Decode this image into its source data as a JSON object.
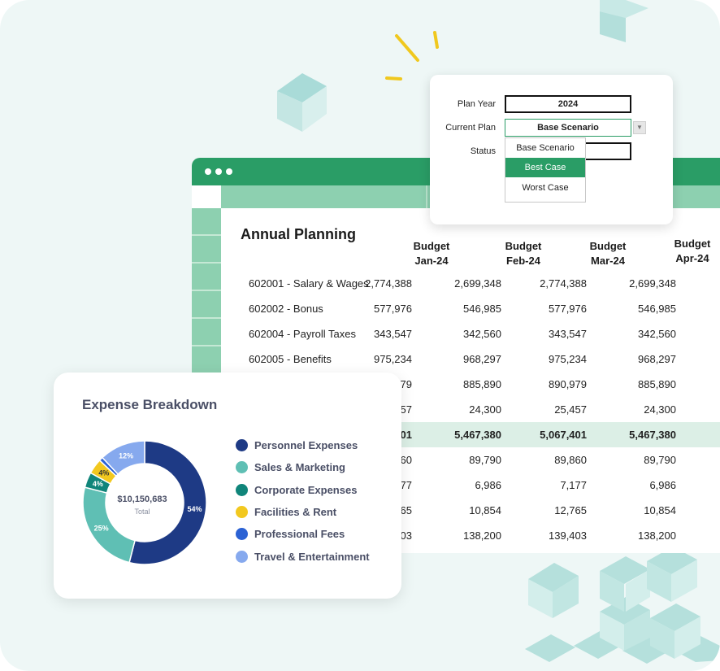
{
  "plan_panel": {
    "plan_year_label": "Plan Year",
    "plan_year_value": "2024",
    "current_plan_label": "Current Plan",
    "current_plan_value": "Base Scenario",
    "status_label": "Status",
    "status_value": "",
    "dropdown_options": [
      "Base Scenario",
      "Best Case",
      "Worst Case"
    ],
    "dropdown_highlighted": "Best Case"
  },
  "sheet": {
    "title": "Annual Planning",
    "columns": [
      {
        "line1": "Budget",
        "line2": "Jan-24"
      },
      {
        "line1": "Budget",
        "line2": "Feb-24"
      },
      {
        "line1": "Budget",
        "line2": "Mar-24"
      },
      {
        "line1": "Budget",
        "line2": "Apr-24"
      }
    ],
    "rows": [
      {
        "label": "602001 - Salary & Wages",
        "values": [
          "2,774,388",
          "2,699,348",
          "2,774,388",
          "2,699,348"
        ]
      },
      {
        "label": "602002 - Bonus",
        "values": [
          "577,976",
          "546,985",
          "577,976",
          "546,985"
        ]
      },
      {
        "label": "602004 - Payroll Taxes",
        "values": [
          "343,547",
          "342,560",
          "343,547",
          "342,560"
        ]
      },
      {
        "label": "602005 - Benefits",
        "values": [
          "975,234",
          "968,297",
          "975,234",
          "968,297"
        ]
      },
      {
        "label": "",
        "values": [
          "890,979",
          "885,890",
          "890,979",
          "885,890"
        ]
      },
      {
        "label": "",
        "values": [
          "25,457",
          "24,300",
          "25,457",
          "24,300"
        ]
      },
      {
        "label": "",
        "values": [
          "5,067,401",
          "5,467,380",
          "5,067,401",
          "5,467,380"
        ],
        "total": true
      },
      {
        "label": "",
        "values": [
          "89,860",
          "89,790",
          "89,860",
          "89,790"
        ]
      },
      {
        "label": "",
        "values": [
          "7,177",
          "6,986",
          "7,177",
          "6,986"
        ]
      },
      {
        "label": "",
        "values": [
          "12,765",
          "10,854",
          "12,765",
          "10,854"
        ]
      },
      {
        "label": "",
        "values": [
          "139,403",
          "138,200",
          "139,403",
          "138,200"
        ]
      }
    ]
  },
  "expense_card": {
    "title": "Expense Breakdown",
    "center_value": "$10,150,683",
    "center_label": "Total",
    "segments": [
      {
        "name": "Personnel Expenses",
        "percent": 54,
        "label": "54%",
        "color": "#1e3a85"
      },
      {
        "name": "Sales & Marketing",
        "percent": 25,
        "label": "25%",
        "color": "#5fbfb4"
      },
      {
        "name": "Corporate Expenses",
        "percent": 4,
        "label": "4%",
        "color": "#10857a"
      },
      {
        "name": "Facilities & Rent",
        "percent": 4,
        "label": "4%",
        "color": "#f2c81f"
      },
      {
        "name": "Professional Fees",
        "percent": 1,
        "label": "",
        "color": "#2b62d4"
      },
      {
        "name": "Travel & Entertainment",
        "percent": 12,
        "label": "12%",
        "color": "#86a9ee"
      }
    ]
  },
  "colors": {
    "accent_green": "#2a9d66",
    "header_mint": "#8dd0b0",
    "total_row": "#dcefe6",
    "title_navy": "#4a4f66"
  }
}
